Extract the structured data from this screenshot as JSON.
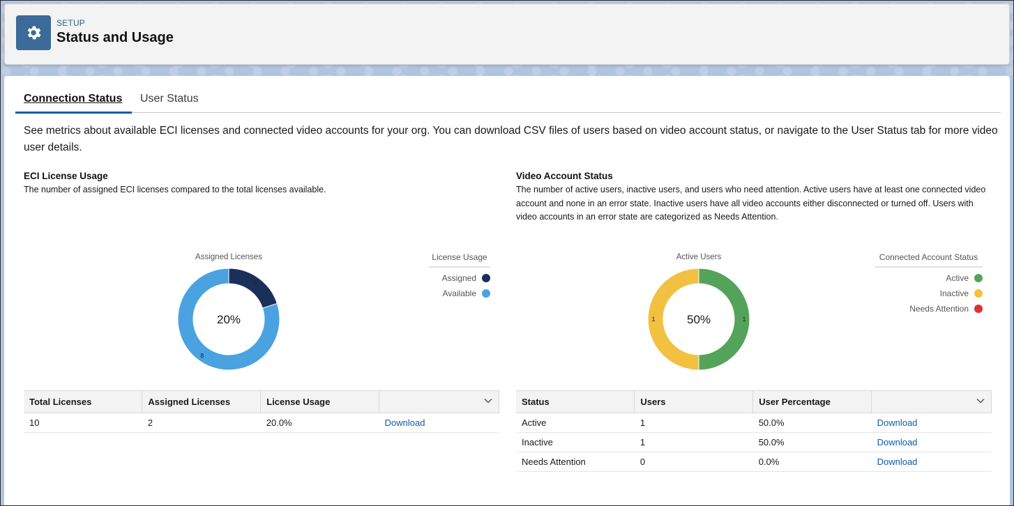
{
  "header": {
    "eyebrow": "SETUP",
    "title": "Status and Usage",
    "icon": "gear-icon"
  },
  "tabs": [
    {
      "label": "Connection Status",
      "active": true
    },
    {
      "label": "User Status",
      "active": false
    }
  ],
  "intro": "See metrics about available ECI licenses and connected video accounts for your org. You can download CSV files of users based on video account status, or navigate to the User Status tab for more video user details.",
  "license_section": {
    "title": "ECI License Usage",
    "description": "The number of assigned ECI licenses compared to the total licenses available.",
    "chart_title": "Assigned Licenses",
    "center_label": "20%",
    "legend_title": "License Usage",
    "legend": [
      {
        "label": "Assigned",
        "color": "#1b2f5b"
      },
      {
        "label": "Available",
        "color": "#4aa2e0"
      }
    ],
    "slices": [
      {
        "label": "Assigned",
        "value": 2,
        "color": "#1b2f5b"
      },
      {
        "label": "Available",
        "value": 8,
        "color": "#4aa2e0"
      }
    ],
    "table": {
      "headers": [
        "Total Licenses",
        "Assigned Licenses",
        "License Usage"
      ],
      "rows": [
        {
          "cells": [
            "10",
            "2",
            "20.0%"
          ],
          "action": "Download"
        }
      ]
    }
  },
  "video_section": {
    "title": "Video Account Status",
    "description": "The number of active users, inactive users, and users who need attention. Active users have at least one connected video account and none in an error state. Inactive users have all video accounts either disconnected or turned off. Users with video accounts in an error state are categorized as Needs Attention.",
    "chart_title": "Active Users",
    "center_label": "50%",
    "legend_title": "Connected Account Status",
    "legend": [
      {
        "label": "Active",
        "color": "#54a35a"
      },
      {
        "label": "Inactive",
        "color": "#f2c141"
      },
      {
        "label": "Needs Attention",
        "color": "#e0302f"
      }
    ],
    "slices": [
      {
        "label": "Active",
        "value": 1,
        "color": "#54a35a"
      },
      {
        "label": "Inactive",
        "value": 1,
        "color": "#f2c141"
      }
    ],
    "table": {
      "headers": [
        "Status",
        "Users",
        "User Percentage"
      ],
      "rows": [
        {
          "cells": [
            "Active",
            "1",
            "50.0%"
          ],
          "action": "Download"
        },
        {
          "cells": [
            "Inactive",
            "1",
            "50.0%"
          ],
          "action": "Download"
        },
        {
          "cells": [
            "Needs Attention",
            "0",
            "0.0%"
          ],
          "action": "Download"
        }
      ]
    }
  },
  "chart_data": [
    {
      "type": "pie",
      "title": "Assigned Licenses",
      "categories": [
        "Assigned",
        "Available"
      ],
      "values": [
        2,
        8
      ],
      "center_label": "20%",
      "legend_title": "License Usage",
      "legend_position": "top-right"
    },
    {
      "type": "pie",
      "title": "Active Users",
      "categories": [
        "Active",
        "Inactive",
        "Needs Attention"
      ],
      "values": [
        1,
        1,
        0
      ],
      "center_label": "50%",
      "legend_title": "Connected Account Status",
      "legend_position": "top-right"
    }
  ]
}
